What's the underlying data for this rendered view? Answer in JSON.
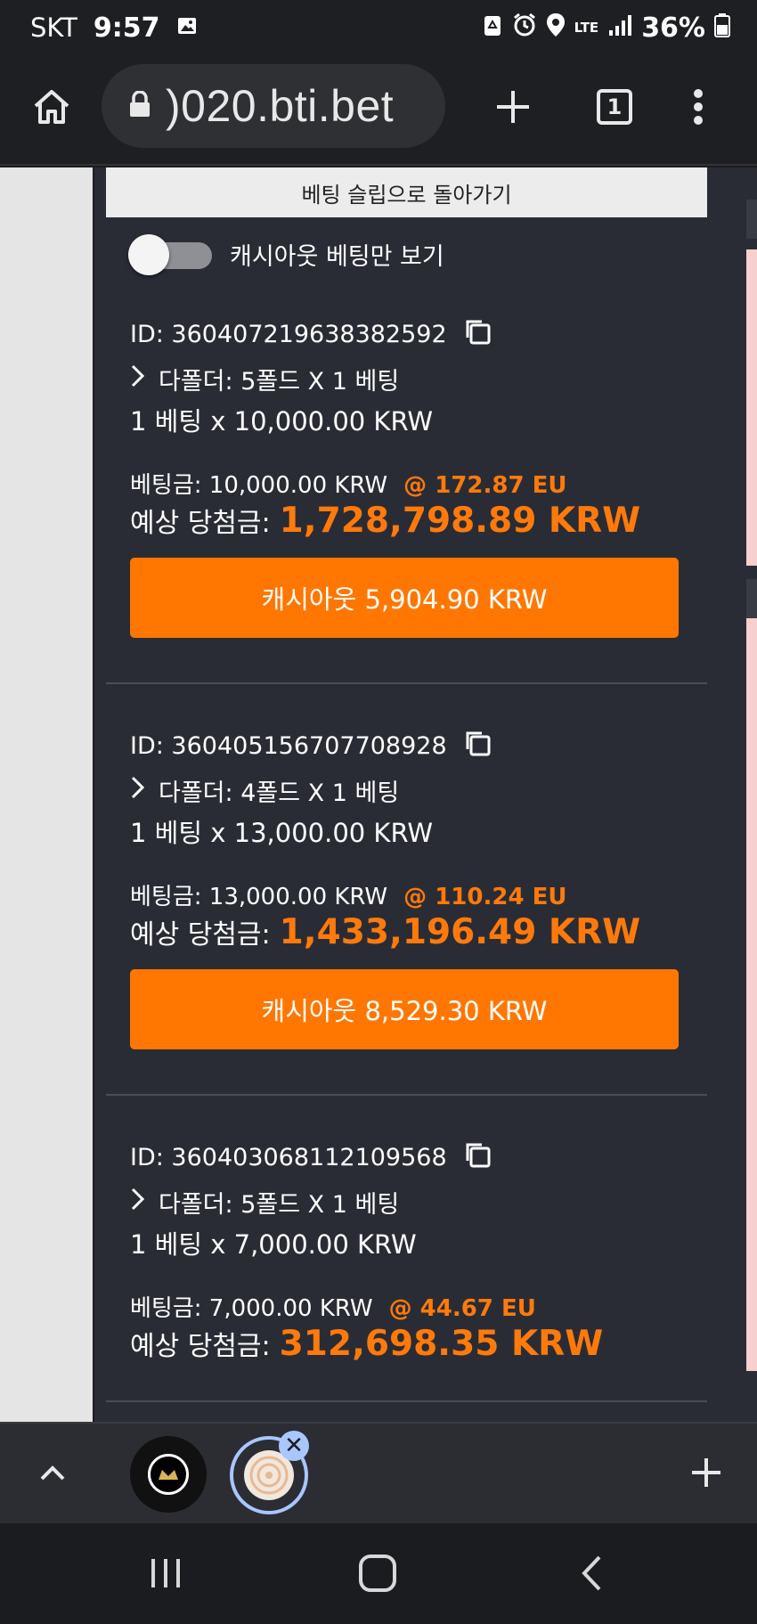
{
  "status_bar": {
    "carrier": "SKT",
    "time": "9:57",
    "network": "LTE",
    "battery": "36%"
  },
  "browser": {
    "url": ")020.bti.bet",
    "tab_count": "1"
  },
  "page": {
    "back_label": "베팅 슬립으로 돌아가기",
    "toggle_label": "캐시아웃 베팅만 보기",
    "toggle_on": false,
    "bets": [
      {
        "id": "ID: 360407219638382592",
        "fold": "다폴더: 5폴드 X 1 베팅",
        "count": "1 베팅 x 10,000.00 KRW",
        "stake": "베팅금: 10,000.00 KRW",
        "odds": "@ 172.87 EU",
        "win_label": "예상 당첨금:",
        "win_value": "1,728,798.89 KRW",
        "cashout": "캐시아웃 5,904.90 KRW"
      },
      {
        "id": "ID: 360405156707708928",
        "fold": "다폴더: 4폴드 X 1 베팅",
        "count": "1 베팅 x 13,000.00 KRW",
        "stake": "베팅금: 13,000.00 KRW",
        "odds": "@ 110.24 EU",
        "win_label": "예상 당첨금:",
        "win_value": "1,433,196.49 KRW",
        "cashout": "캐시아웃 8,529.30 KRW"
      },
      {
        "id": "ID: 360403068112109568",
        "fold": "다폴더: 5폴드 X 1 베팅",
        "count": "1 베팅 x 7,000.00 KRW",
        "stake": "베팅금: 7,000.00 KRW",
        "odds": "@ 44.67 EU",
        "win_label": "예상 당첨금:",
        "win_value": "312,698.35 KRW"
      }
    ]
  },
  "colors": {
    "accent": "#ff7700",
    "page_bg": "#2a2c35",
    "chrome_bg": "#1e1f23"
  }
}
